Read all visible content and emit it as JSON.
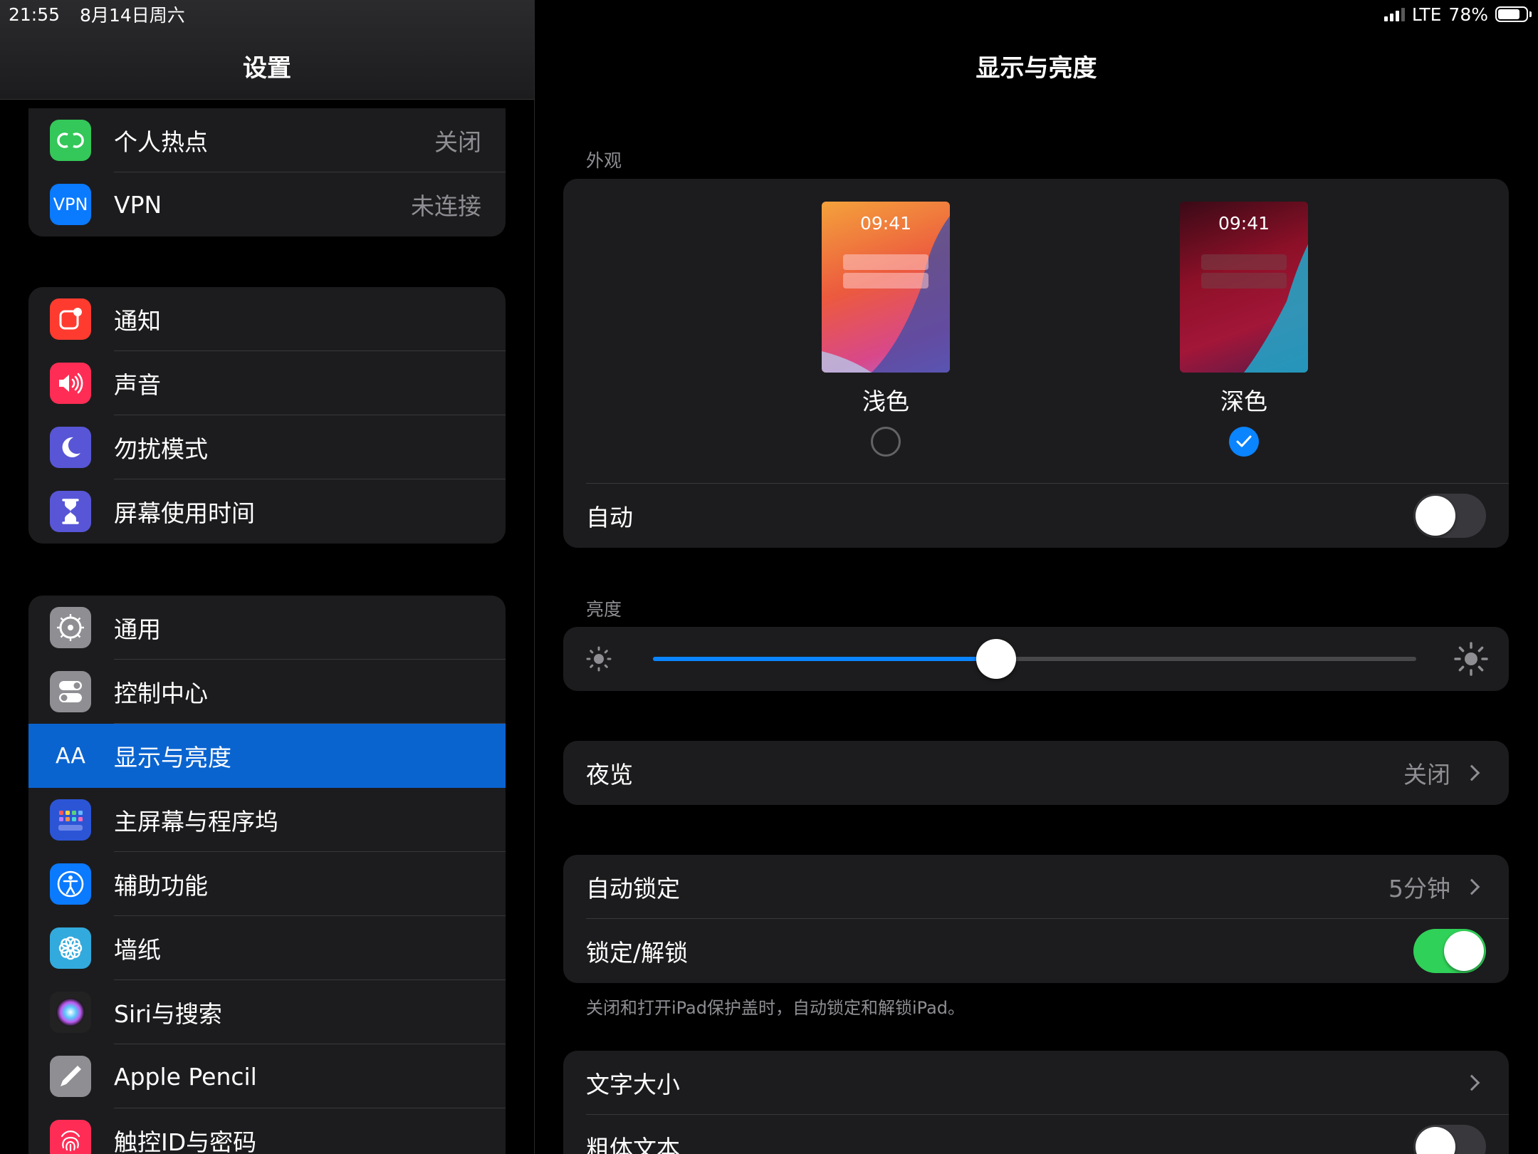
{
  "status_bar": {
    "time": "21:55",
    "date": "8月14日周六",
    "network": "LTE",
    "battery": "78%",
    "battery_level": 0.78
  },
  "sidebar": {
    "title": "设置",
    "groups": [
      [
        {
          "label": "个人热点",
          "value": "关闭",
          "icon": "hotspot-icon",
          "color": "#34c759"
        },
        {
          "label": "VPN",
          "value": "未连接",
          "icon": "vpn-icon",
          "icon_text": "VPN",
          "color": "#0a7aff"
        }
      ],
      [
        {
          "label": "通知",
          "icon": "notifications-icon",
          "color": "#ff3b30"
        },
        {
          "label": "声音",
          "icon": "sounds-icon",
          "color": "#ff2d55"
        },
        {
          "label": "勿扰模式",
          "icon": "moon-icon",
          "color": "#5856d6"
        },
        {
          "label": "屏幕使用时间",
          "icon": "hourglass-icon",
          "color": "#5856d6"
        }
      ],
      [
        {
          "label": "通用",
          "icon": "gear-icon",
          "color": "#8e8e93"
        },
        {
          "label": "控制中心",
          "icon": "control-center-icon",
          "color": "#8e8e93"
        },
        {
          "label": "显示与亮度",
          "icon": "display-brightness-icon",
          "icon_text": "AA",
          "color": "#0a7aff",
          "selected": true
        },
        {
          "label": "主屏幕与程序坞",
          "icon": "home-screen-icon",
          "color": "#2c55d6"
        },
        {
          "label": "辅助功能",
          "icon": "accessibility-icon",
          "color": "#0a7aff"
        },
        {
          "label": "墙纸",
          "icon": "wallpaper-icon",
          "color": "#33aadd"
        },
        {
          "label": "Siri与搜索",
          "icon": "siri-icon",
          "color": "#222"
        },
        {
          "label": "Apple Pencil",
          "icon": "pencil-icon",
          "color": "#8e8e93"
        },
        {
          "label": "触控ID与密码",
          "icon": "fingerprint-icon",
          "color": "#ff2d55"
        }
      ]
    ]
  },
  "main": {
    "title": "显示与亮度",
    "appearance": {
      "section_label": "外观",
      "preview_time": "09:41",
      "light": {
        "label": "浅色",
        "selected": false
      },
      "dark": {
        "label": "深色",
        "selected": true
      },
      "auto_label": "自动",
      "auto_on": false
    },
    "brightness": {
      "section_label": "亮度",
      "level": 0.45
    },
    "night_shift": {
      "label": "夜览",
      "value": "关闭"
    },
    "auto_lock": {
      "label": "自动锁定",
      "value": "5分钟"
    },
    "lock_unlock": {
      "label": "锁定/解锁",
      "on": true,
      "footnote": "关闭和打开iPad保护盖时，自动锁定和解锁iPad。"
    },
    "text_size": {
      "label": "文字大小"
    },
    "bold_text": {
      "label": "粗体文本",
      "on": false
    }
  }
}
